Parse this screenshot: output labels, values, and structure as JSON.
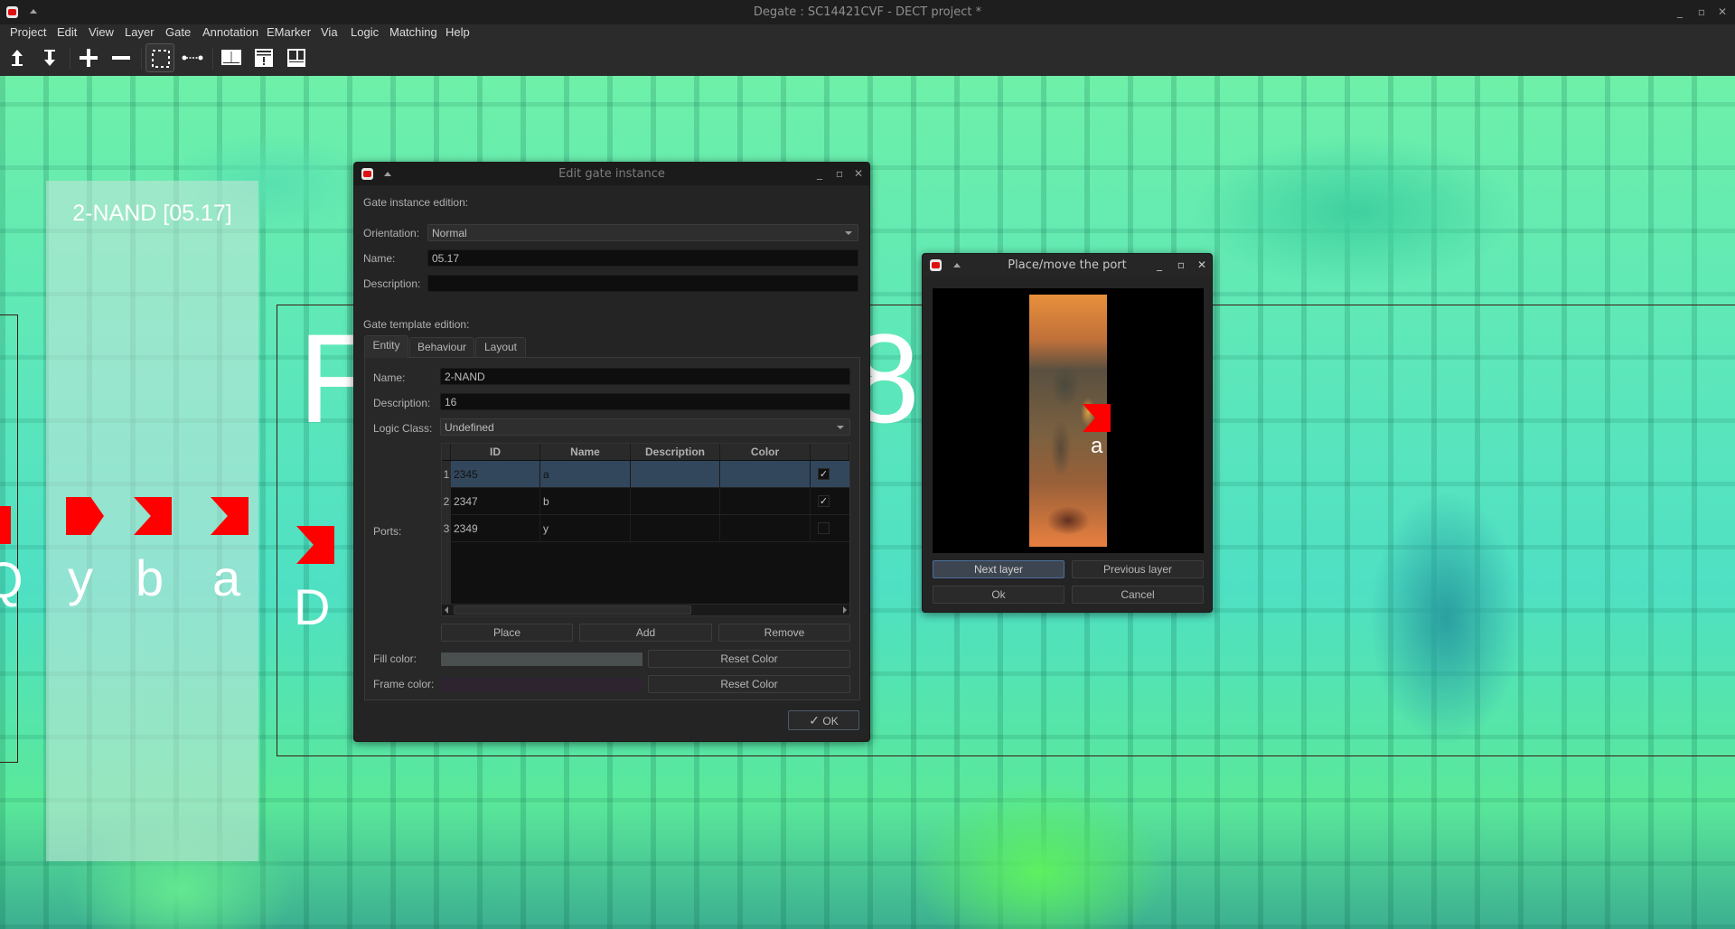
{
  "window": {
    "title": "Degate : SC14421CVF - DECT project *",
    "controls": [
      "minimize",
      "maximize",
      "close"
    ]
  },
  "menubar": {
    "items": [
      "Project",
      "Edit",
      "View",
      "Layer",
      "Gate",
      "Annotation",
      "EMarker",
      "Via",
      "Logic",
      "Matching",
      "Help"
    ]
  },
  "toolbar": {
    "icons": [
      "layer-up-icon",
      "layer-down-icon",
      "zoom-in-icon",
      "zoom-out-icon",
      "area-select-icon",
      "wire-tool-icon",
      "gate-library-icon",
      "gate-template-icon",
      "gate-layout-icon"
    ],
    "active": "area-select-icon"
  },
  "canvas": {
    "gate_label": "2-NAND [05.17]",
    "ports": [
      "y",
      "b",
      "a"
    ],
    "left_port_label": "Q",
    "neighbor_port_label": "D",
    "big_letter_left": "F",
    "big_letter_right": "8",
    "colors": {
      "port": "#ff0000",
      "label": "#ffffff"
    }
  },
  "edit_dialog": {
    "title": "Edit gate instance",
    "instance_section": "Gate instance edition:",
    "orientation_label": "Orientation:",
    "orientation_value": "Normal",
    "name_label": "Name:",
    "name_value": "05.17",
    "description_label": "Description:",
    "description_value": "",
    "template_section": "Gate template edition:",
    "tabs": [
      "Entity",
      "Behaviour",
      "Layout"
    ],
    "active_tab": "Entity",
    "entity": {
      "name_label": "Name:",
      "name_value": "2-NAND",
      "description_label": "Description:",
      "description_value": "16",
      "logic_class_label": "Logic Class:",
      "logic_class_value": "Undefined",
      "ports_label": "Ports:",
      "columns": [
        "ID",
        "Name",
        "Description",
        "Color",
        ""
      ],
      "rows": [
        {
          "num": "1",
          "id": "2345",
          "name": "a",
          "description": "",
          "color": "",
          "checked": true,
          "selected": true
        },
        {
          "num": "2",
          "id": "2347",
          "name": "b",
          "description": "",
          "color": "",
          "checked": true,
          "selected": false
        },
        {
          "num": "3",
          "id": "2349",
          "name": "y",
          "description": "",
          "color": "",
          "checked": false,
          "selected": false
        }
      ],
      "place_button": "Place",
      "add_button": "Add",
      "remove_button": "Remove",
      "fill_color_label": "Fill color:",
      "fill_color": "#4a4f4f",
      "frame_color_label": "Frame color:",
      "frame_color": "#2e2430",
      "reset_color_button": "Reset Color"
    },
    "ok_button": "OK",
    "check_mark": "✓"
  },
  "place_dialog": {
    "title": "Place/move the port",
    "port_label": "a",
    "next_layer_button": "Next layer",
    "previous_layer_button": "Previous layer",
    "ok_button": "Ok",
    "cancel_button": "Cancel"
  }
}
